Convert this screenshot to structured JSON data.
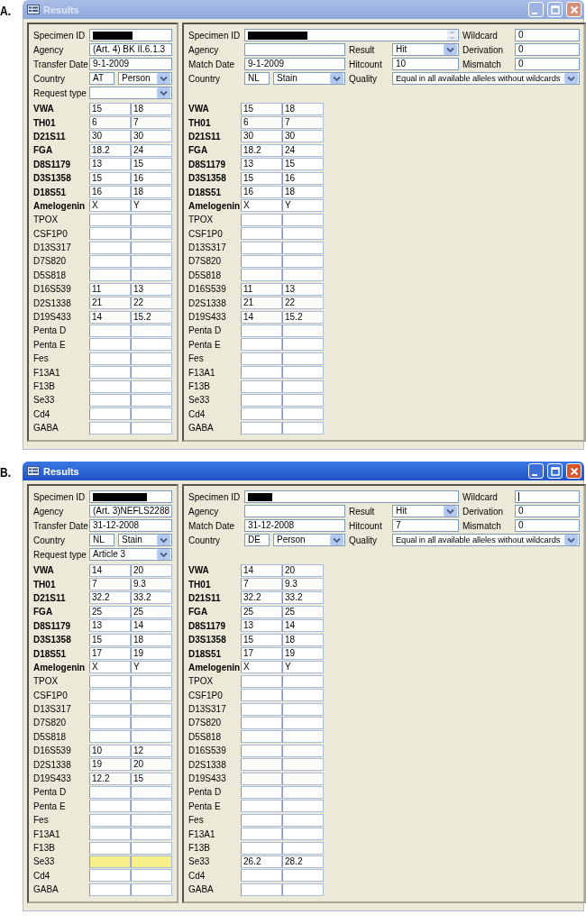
{
  "figures": [
    {
      "label": "A.",
      "window": {
        "title": "Results",
        "active": false
      },
      "left": {
        "specimen_id": {
          "label": "Specimen ID",
          "redaction": {
            "level": 0.52
          }
        },
        "agency": {
          "label": "Agency",
          "value": "(Art. 4) BK II.6.1.3"
        },
        "transfer_date": {
          "label": "Transfer Date",
          "value": "9-1-2009"
        },
        "country": {
          "label": "Country",
          "code": "AT",
          "type": "Person"
        },
        "request_type": {
          "label": "Request type"
        },
        "loci": [
          {
            "name": "VWA",
            "bold": true,
            "alleles": [
              "15",
              "18"
            ],
            "highlighted": false
          },
          {
            "name": "TH01",
            "bold": true,
            "alleles": [
              "6",
              "7"
            ],
            "highlighted": false
          },
          {
            "name": "D21S11",
            "bold": true,
            "alleles": [
              "30",
              "30"
            ],
            "highlighted": false
          },
          {
            "name": "FGA",
            "bold": true,
            "alleles": [
              "18.2",
              "24"
            ],
            "highlighted": false
          },
          {
            "name": "D8S1179",
            "bold": true,
            "alleles": [
              "13",
              "15"
            ],
            "highlighted": false
          },
          {
            "name": "D3S1358",
            "bold": true,
            "alleles": [
              "15",
              "16"
            ],
            "highlighted": false
          },
          {
            "name": "D18S51",
            "bold": true,
            "alleles": [
              "16",
              "18"
            ],
            "highlighted": false
          },
          {
            "name": "Amelogenin",
            "bold": true,
            "alleles": [
              "X",
              "Y"
            ],
            "highlighted": false
          },
          {
            "name": "TPOX",
            "bold": false,
            "highlighted": false
          },
          {
            "name": "CSF1P0",
            "bold": false,
            "highlighted": false
          },
          {
            "name": "D13S317",
            "bold": false,
            "highlighted": false
          },
          {
            "name": "D7S820",
            "bold": false,
            "highlighted": false
          },
          {
            "name": "D5S818",
            "bold": false,
            "highlighted": false
          },
          {
            "name": "D16S539",
            "bold": false,
            "alleles": [
              "11",
              "13"
            ],
            "highlighted": false
          },
          {
            "name": "D2S1338",
            "bold": false,
            "alleles": [
              "21",
              "22"
            ],
            "highlighted": false
          },
          {
            "name": "D19S433",
            "bold": false,
            "alleles": [
              "14",
              "15.2"
            ],
            "highlighted": false
          },
          {
            "name": "Penta D",
            "bold": false,
            "highlighted": false
          },
          {
            "name": "Penta E",
            "bold": false,
            "highlighted": false
          },
          {
            "name": "Fes",
            "bold": false,
            "highlighted": false
          },
          {
            "name": "F13A1",
            "bold": false,
            "highlighted": false
          },
          {
            "name": "F13B",
            "bold": false,
            "highlighted": false
          },
          {
            "name": "Se33",
            "bold": false,
            "highlighted": false
          },
          {
            "name": "Cd4",
            "bold": false,
            "highlighted": false
          },
          {
            "name": "GABA",
            "bold": false,
            "highlighted": false
          }
        ]
      },
      "right": {
        "specimen_id": {
          "label": "Specimen ID",
          "redaction": {
            "level": 0.34
          },
          "spinner": true
        },
        "agency": {
          "label": "Agency"
        },
        "match_date": {
          "label": "Match Date",
          "value": "9-1-2009"
        },
        "country": {
          "label": "Country",
          "code": "NL",
          "type": "Stain"
        },
        "result": {
          "label": "Result",
          "value": "Hit"
        },
        "hitcount": {
          "label": "Hitcount",
          "value": "10"
        },
        "quality": {
          "label": "Quality",
          "value": "Equal in all available alleles without wildcards"
        },
        "wildcard": {
          "label": "Wildcard",
          "value": "0",
          "focused": false
        },
        "derivation": {
          "label": "Derivation",
          "value": "0"
        },
        "mismatch": {
          "label": "Mismatch",
          "value": "0"
        },
        "loci": [
          {
            "name": "VWA",
            "bold": true,
            "alleles": [
              "15",
              "18"
            ]
          },
          {
            "name": "TH01",
            "bold": true,
            "alleles": [
              "6",
              "7"
            ]
          },
          {
            "name": "D21S11",
            "bold": true,
            "alleles": [
              "30",
              "30"
            ]
          },
          {
            "name": "FGA",
            "bold": true,
            "alleles": [
              "18.2",
              "24"
            ]
          },
          {
            "name": "D8S1179",
            "bold": true,
            "alleles": [
              "13",
              "15"
            ]
          },
          {
            "name": "D3S1358",
            "bold": true,
            "alleles": [
              "15",
              "16"
            ]
          },
          {
            "name": "D18S51",
            "bold": true,
            "alleles": [
              "16",
              "18"
            ]
          },
          {
            "name": "Amelogenin",
            "bold": true,
            "alleles": [
              "X",
              "Y"
            ]
          },
          {
            "name": "TPOX",
            "bold": false
          },
          {
            "name": "CSF1P0",
            "bold": false
          },
          {
            "name": "D13S317",
            "bold": false
          },
          {
            "name": "D7S820",
            "bold": false
          },
          {
            "name": "D5S818",
            "bold": false
          },
          {
            "name": "D16S539",
            "bold": false,
            "alleles": [
              "11",
              "13"
            ]
          },
          {
            "name": "D2S1338",
            "bold": false,
            "alleles": [
              "21",
              "22"
            ]
          },
          {
            "name": "D19S433",
            "bold": false,
            "alleles": [
              "14",
              "15.2"
            ]
          },
          {
            "name": "Penta D",
            "bold": false
          },
          {
            "name": "Penta E",
            "bold": false
          },
          {
            "name": "Fes",
            "bold": false
          },
          {
            "name": "F13A1",
            "bold": false
          },
          {
            "name": "F13B",
            "bold": false
          },
          {
            "name": "Se33",
            "bold": false
          },
          {
            "name": "Cd4",
            "bold": false
          },
          {
            "name": "GABA",
            "bold": false
          }
        ]
      }
    },
    {
      "label": "B.",
      "window": {
        "title": "Results",
        "active": true
      },
      "left": {
        "specimen_id": {
          "label": "Specimen ID",
          "redaction": {
            "level": 0.72
          }
        },
        "agency": {
          "label": "Agency",
          "value": "(Art. 3)NEFLS2288"
        },
        "transfer_date": {
          "label": "Transfer Date",
          "value": "31-12-2008"
        },
        "country": {
          "label": "Country",
          "code": "NL",
          "type": "Stain"
        },
        "request_type": {
          "label": "Request type",
          "value": "Article 3"
        },
        "loci": [
          {
            "name": "VWA",
            "bold": true,
            "alleles": [
              "14",
              "20"
            ],
            "highlighted": false
          },
          {
            "name": "TH01",
            "bold": true,
            "alleles": [
              "7",
              "9.3"
            ],
            "highlighted": false
          },
          {
            "name": "D21S11",
            "bold": true,
            "alleles": [
              "32.2",
              "33.2"
            ],
            "highlighted": false
          },
          {
            "name": "FGA",
            "bold": true,
            "alleles": [
              "25",
              "25"
            ],
            "highlighted": false
          },
          {
            "name": "D8S1179",
            "bold": true,
            "alleles": [
              "13",
              "14"
            ],
            "highlighted": false
          },
          {
            "name": "D3S1358",
            "bold": true,
            "alleles": [
              "15",
              "18"
            ],
            "highlighted": false
          },
          {
            "name": "D18S51",
            "bold": true,
            "alleles": [
              "17",
              "19"
            ],
            "highlighted": false
          },
          {
            "name": "Amelogenin",
            "bold": true,
            "alleles": [
              "X",
              "Y"
            ],
            "highlighted": false
          },
          {
            "name": "TPOX",
            "bold": false,
            "highlighted": false
          },
          {
            "name": "CSF1P0",
            "bold": false,
            "highlighted": false
          },
          {
            "name": "D13S317",
            "bold": false,
            "highlighted": false
          },
          {
            "name": "D7S820",
            "bold": false,
            "highlighted": false
          },
          {
            "name": "D5S818",
            "bold": false,
            "highlighted": false
          },
          {
            "name": "D16S539",
            "bold": false,
            "alleles": [
              "10",
              "12"
            ],
            "highlighted": false
          },
          {
            "name": "D2S1338",
            "bold": false,
            "alleles": [
              "19",
              "20"
            ],
            "highlighted": false
          },
          {
            "name": "D19S433",
            "bold": false,
            "alleles": [
              "12.2",
              "15"
            ],
            "highlighted": false
          },
          {
            "name": "Penta D",
            "bold": false,
            "highlighted": false
          },
          {
            "name": "Penta E",
            "bold": false,
            "highlighted": false
          },
          {
            "name": "Fes",
            "bold": false,
            "highlighted": false
          },
          {
            "name": "F13A1",
            "bold": false,
            "highlighted": false
          },
          {
            "name": "F13B",
            "bold": false,
            "highlighted": false
          },
          {
            "name": "Se33",
            "bold": false,
            "highlighted": true
          },
          {
            "name": "Cd4",
            "bold": false,
            "highlighted": false
          },
          {
            "name": "GABA",
            "bold": false,
            "highlighted": false
          }
        ]
      },
      "right": {
        "specimen_id": {
          "label": "Specimen ID",
          "redaction": {
            "level": 0.14
          },
          "spinner": false
        },
        "agency": {
          "label": "Agency"
        },
        "match_date": {
          "label": "Match Date",
          "value": "31-12-2008"
        },
        "country": {
          "label": "Country",
          "code": "DE",
          "type": "Person"
        },
        "result": {
          "label": "Result",
          "value": "Hit"
        },
        "hitcount": {
          "label": "Hitcount",
          "value": "7"
        },
        "quality": {
          "label": "Quality",
          "value": "Equal in all available alleles without wildcards"
        },
        "wildcard": {
          "label": "Wildcard",
          "focused": true
        },
        "derivation": {
          "label": "Derivation",
          "value": "0"
        },
        "mismatch": {
          "label": "Mismatch",
          "value": "0"
        },
        "loci": [
          {
            "name": "VWA",
            "bold": true,
            "alleles": [
              "14",
              "20"
            ]
          },
          {
            "name": "TH01",
            "bold": true,
            "alleles": [
              "7",
              "9.3"
            ]
          },
          {
            "name": "D21S11",
            "bold": true,
            "alleles": [
              "32.2",
              "33.2"
            ]
          },
          {
            "name": "FGA",
            "bold": true,
            "alleles": [
              "25",
              "25"
            ]
          },
          {
            "name": "D8S1179",
            "bold": true,
            "alleles": [
              "13",
              "14"
            ]
          },
          {
            "name": "D3S1358",
            "bold": true,
            "alleles": [
              "15",
              "18"
            ]
          },
          {
            "name": "D18S51",
            "bold": true,
            "alleles": [
              "17",
              "19"
            ]
          },
          {
            "name": "Amelogenin",
            "bold": true,
            "alleles": [
              "X",
              "Y"
            ]
          },
          {
            "name": "TPOX",
            "bold": false
          },
          {
            "name": "CSF1P0",
            "bold": false
          },
          {
            "name": "D13S317",
            "bold": false
          },
          {
            "name": "D7S820",
            "bold": false
          },
          {
            "name": "D5S818",
            "bold": false
          },
          {
            "name": "D16S539",
            "bold": false
          },
          {
            "name": "D2S1338",
            "bold": false
          },
          {
            "name": "D19S433",
            "bold": false
          },
          {
            "name": "Penta D",
            "bold": false
          },
          {
            "name": "Penta E",
            "bold": false
          },
          {
            "name": "Fes",
            "bold": false
          },
          {
            "name": "F13A1",
            "bold": false
          },
          {
            "name": "F13B",
            "bold": false
          },
          {
            "name": "Se33",
            "bold": false,
            "alleles": [
              "26.2",
              "28.2"
            ]
          },
          {
            "name": "Cd4",
            "bold": false
          },
          {
            "name": "GABA",
            "bold": false
          }
        ]
      }
    }
  ]
}
